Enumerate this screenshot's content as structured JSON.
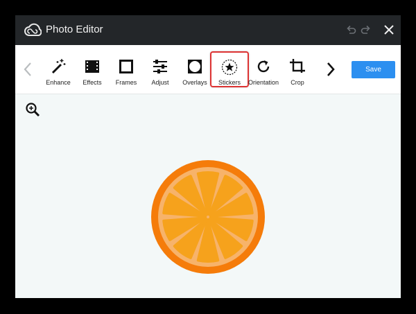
{
  "app": {
    "title": "Photo Editor",
    "logo_icon": "creative-cloud-icon"
  },
  "titlebar": {
    "undo_icon": "undo-icon",
    "redo_icon": "redo-icon",
    "close_icon": "close-icon"
  },
  "toolbar": {
    "prev_icon": "chevron-left-icon",
    "next_icon": "chevron-right-icon",
    "tools": [
      {
        "label": "Enhance",
        "icon": "magic-wand-icon"
      },
      {
        "label": "Effects",
        "icon": "film-strip-icon"
      },
      {
        "label": "Frames",
        "icon": "frame-icon"
      },
      {
        "label": "Adjust",
        "icon": "sliders-icon"
      },
      {
        "label": "Overlays",
        "icon": "overlay-icon"
      },
      {
        "label": "Stickers",
        "icon": "star-sticker-icon",
        "selected": true
      },
      {
        "label": "Orientation",
        "icon": "rotate-icon"
      },
      {
        "label": "Crop",
        "icon": "crop-icon"
      }
    ],
    "save_label": "Save"
  },
  "canvas": {
    "zoom_icon": "zoom-in-icon",
    "image_subject": "orange-slice"
  },
  "colors": {
    "titlebar": "#232629",
    "accent_save": "#2c8ff0",
    "selection_border": "#dd3333",
    "canvas_bg": "#f3f8f8",
    "orange_rind": "#f57c0a",
    "orange_pith": "#f7b36a",
    "orange_segment": "#f6a21c"
  }
}
